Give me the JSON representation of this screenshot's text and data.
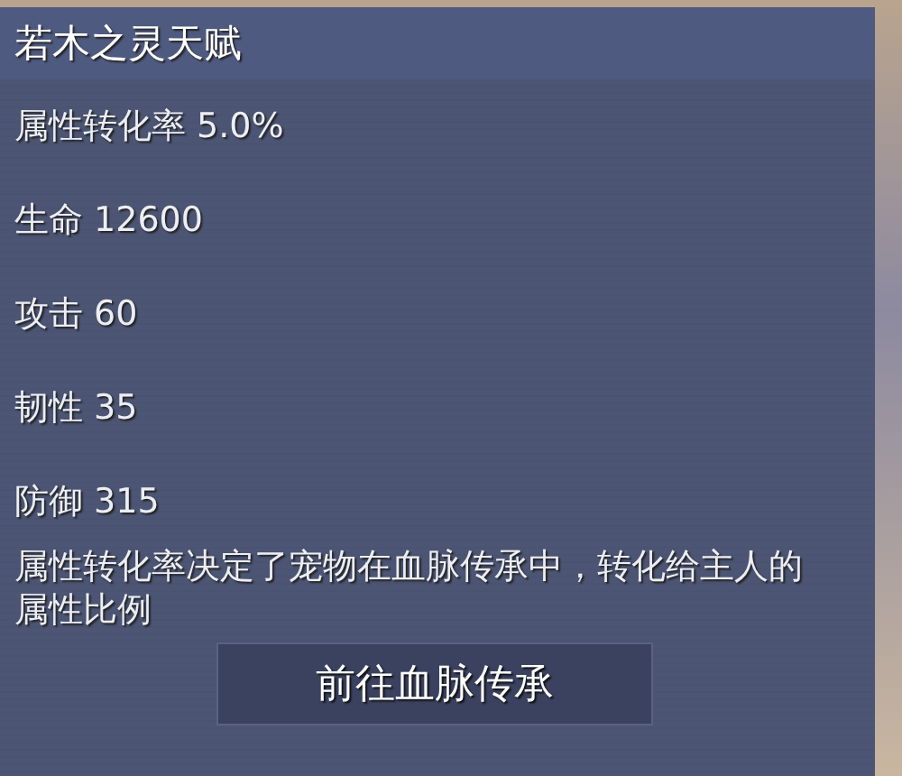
{
  "tooltip": {
    "title": "若木之灵天赋",
    "stats": [
      {
        "label": "属性转化率 5.0%"
      },
      {
        "label": "生命 12600"
      },
      {
        "label": "攻击 60"
      },
      {
        "label": "韧性 35"
      },
      {
        "label": "防御 315"
      }
    ],
    "description": "属性转化率决定了宠物在血脉传承中，转化给主人的属性比例",
    "button": "前往血脉传承"
  }
}
